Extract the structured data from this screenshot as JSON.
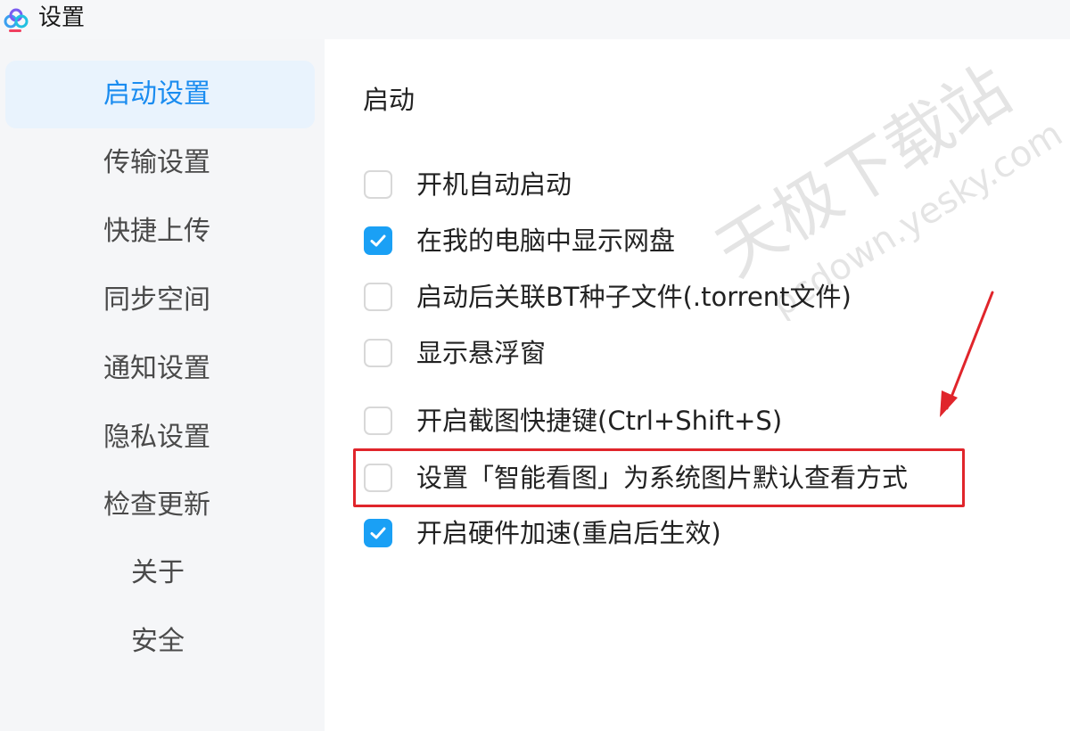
{
  "window": {
    "title": "设置"
  },
  "colors": {
    "accent": "#1a8cf0",
    "checkbox_checked": "#1aa0f5",
    "annotation_red": "#e0252b",
    "sidebar_bg": "#f5f6f8",
    "active_bg": "#e9f3fd"
  },
  "sidebar": {
    "items": [
      {
        "label": "启动设置",
        "active": true
      },
      {
        "label": "传输设置",
        "active": false
      },
      {
        "label": "快捷上传",
        "active": false
      },
      {
        "label": "同步空间",
        "active": false
      },
      {
        "label": "通知设置",
        "active": false
      },
      {
        "label": "隐私设置",
        "active": false
      },
      {
        "label": "检查更新",
        "active": false
      },
      {
        "label": "关于",
        "active": false
      },
      {
        "label": "安全",
        "active": false
      }
    ]
  },
  "main": {
    "section_title": "启动",
    "options": [
      {
        "label": "开机自动启动",
        "checked": false
      },
      {
        "label": "在我的电脑中显示网盘",
        "checked": true
      },
      {
        "label": "启动后关联BT种子文件(.torrent文件)",
        "checked": false
      },
      {
        "label": "显示悬浮窗",
        "checked": false
      },
      {
        "label": "开启截图快捷键(Ctrl+Shift+S)",
        "checked": false
      },
      {
        "label": "设置「智能看图」为系统图片默认查看方式",
        "checked": false
      },
      {
        "label": "开启硬件加速(重启后生效)",
        "checked": true
      }
    ]
  },
  "watermark": {
    "line1": "天极下载站",
    "line2": "pcdown.yesky.com"
  },
  "icons": {
    "app_logo": "cloud-logo-icon",
    "check": "check-icon",
    "arrow": "red-arrow-icon"
  }
}
